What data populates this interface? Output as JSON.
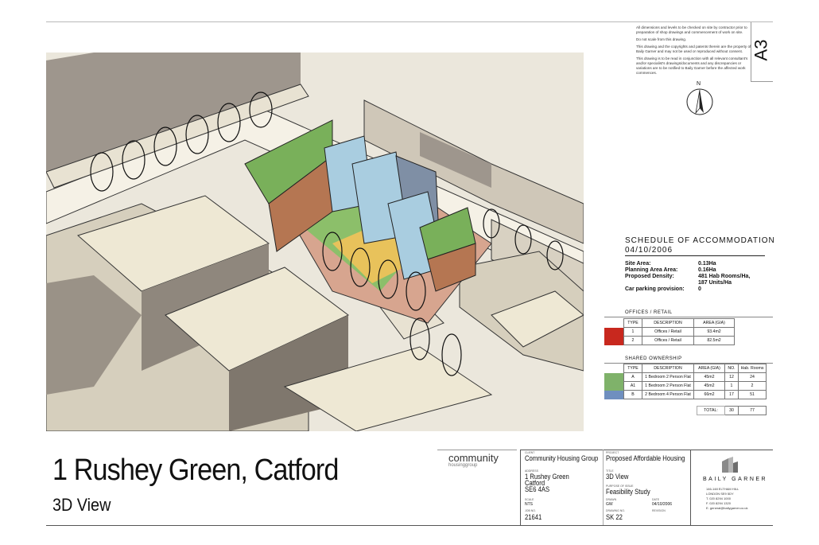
{
  "sheet_size": "A3",
  "notes": [
    "All dimensions and levels to be checked on site by contractor prior to preparation of shop drawings and commencement of work on site.",
    "Do not scale from this drawing.",
    "This drawing and the copyrights and patents therein are the property of Baily Garner and may not be used or reproduced without consent.",
    "This drawing is to be read in conjunction with all relevant consultant's and/or specialist's drawings/documents and any discrepancies or variations are to be notified to Baily Garner before the affected work commences."
  ],
  "north_label": "N",
  "schedule": {
    "title": "SCHEDULE OF ACCOMMODATION",
    "date": "04/10/2006",
    "site": [
      {
        "k": "Site Area:",
        "v": "0.13Ha"
      },
      {
        "k": "Planning Area Area:",
        "v": "0.16Ha"
      },
      {
        "k": "Proposed Density:",
        "v": "481 Hab Rooms/Ha,"
      },
      {
        "k": "",
        "v": "187 Units/Ha"
      },
      {
        "k": "Car parking provision:",
        "v": "0"
      }
    ],
    "offices_title": "OFFICES / RETAIL",
    "offices_headers": [
      "TYPE",
      "DESCRIPTION",
      "AREA (GIA)"
    ],
    "offices_rows": [
      {
        "color": "#c8281e",
        "type": "1",
        "desc": "Offices / Retail",
        "area": "93.4m2"
      },
      {
        "color": "#c8281e",
        "type": "2",
        "desc": "Offices / Retail",
        "area": "82.5m2"
      }
    ],
    "shared_title": "SHARED OWNERSHIP",
    "shared_headers": [
      "TYPE",
      "DESCRIPTION",
      "AREA (GIA)",
      "NO.",
      "Hab. Rooms"
    ],
    "shared_rows": [
      {
        "color": "#7fb26a",
        "type": "A",
        "desc": "1 Bedroom 2 Person Flat",
        "area": "45m2",
        "no": "12",
        "hab": "24"
      },
      {
        "color": "#7fb26a",
        "type": "A1",
        "desc": "1 Bedroom 2 Person Flat",
        "area": "45m2",
        "no": "1",
        "hab": "2"
      },
      {
        "color": "#6f8fbf",
        "type": "B",
        "desc": "2 Bedroom 4 Person Flat",
        "area": "66m2",
        "no": "17",
        "hab": "51"
      }
    ],
    "total_label": "TOTAL:",
    "total_no": "30",
    "total_hab": "77"
  },
  "title": "1 Rushey Green, Catford",
  "subtitle": "3D View",
  "logo": {
    "main": "community",
    "sub": "housinggroup"
  },
  "titleblock": {
    "client_label": "CLIENT",
    "client": "Community Housing Group",
    "project_label": "PROJECT",
    "project": "Proposed Affordable Housing",
    "address_label": "ADDRESS",
    "address": [
      "1 Rushey Green",
      "Catford",
      "SE6 4AS"
    ],
    "title_label": "TITLE",
    "drawing_title": "3D View",
    "purpose_label": "PURPOSE OF ISSUE",
    "purpose": "Feasibility Study",
    "scale_label": "SCALE",
    "scale": "NTS",
    "drawn_label": "DRAWN",
    "drawn": "GW",
    "date_label": "DATE",
    "date": "04/10/2006",
    "job_label": "JOB NO.",
    "job": "21641",
    "drawing_label": "DRAWING NO.",
    "drawing_no": "SK 22",
    "revision_label": "REVISION"
  },
  "architect": {
    "name": "BAILY GARNER",
    "address": [
      "146-148 ELTHAM HILL",
      "LONDON SE9 5DY",
      "T. 020 8294 1000",
      "F. 020 8294 1320",
      "E. general@bailygarner.co.uk"
    ]
  }
}
